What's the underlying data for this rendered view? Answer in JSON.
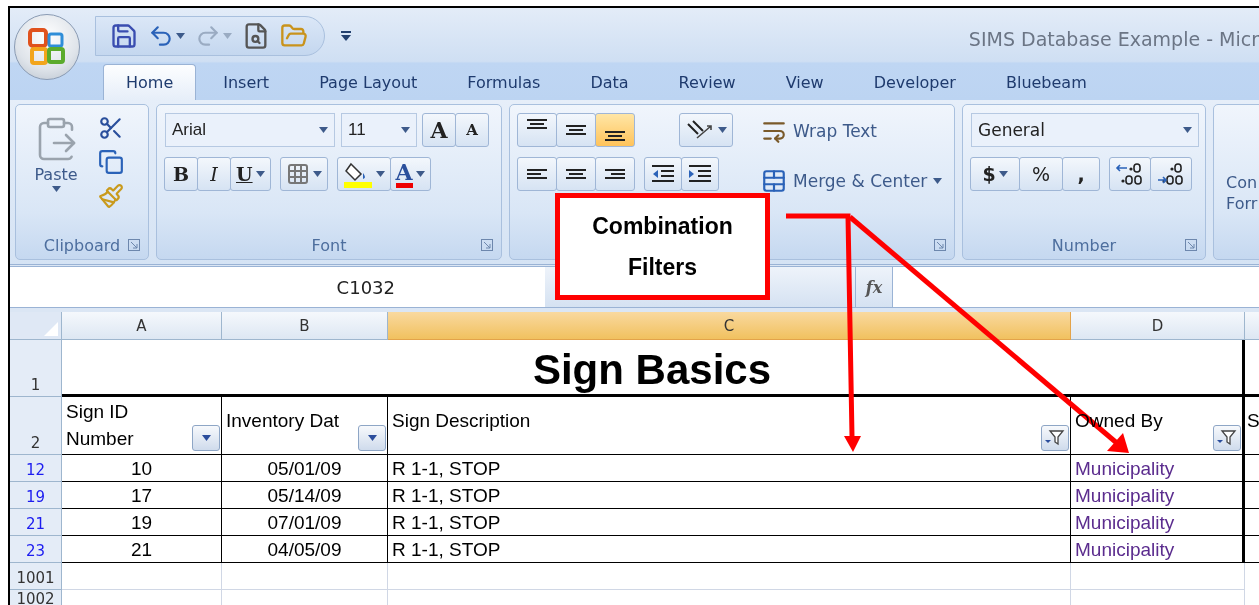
{
  "window": {
    "title": "SIMS Database Example - Micr"
  },
  "tabs": [
    {
      "label": "Home",
      "selected": true
    },
    {
      "label": "Insert",
      "selected": false
    },
    {
      "label": "Page Layout",
      "selected": false
    },
    {
      "label": "Formulas",
      "selected": false
    },
    {
      "label": "Data",
      "selected": false
    },
    {
      "label": "Review",
      "selected": false
    },
    {
      "label": "View",
      "selected": false
    },
    {
      "label": "Developer",
      "selected": false
    },
    {
      "label": "Bluebeam",
      "selected": false
    }
  ],
  "ribbon": {
    "clipboard": {
      "paste": "Paste",
      "label": "Clipboard"
    },
    "font": {
      "name": "Arial",
      "size": "11",
      "grow": "A",
      "shrink": "A",
      "bold": "B",
      "italic": "I",
      "underline": "U",
      "font_color": "A",
      "label": "Font"
    },
    "alignment": {
      "vertical": [
        {
          "selected": false
        },
        {
          "selected": false
        },
        {
          "selected": true
        }
      ],
      "wrap_text": "Wrap Text",
      "merge_center": "Merge & Center"
    },
    "number": {
      "format": "General",
      "currency": "$",
      "percent": "%",
      "comma": ",",
      "label": "Number"
    },
    "styles": {
      "line_1": "Con",
      "line_2": "Forr"
    }
  },
  "formula_bar": {
    "name_box": "C1032",
    "fx": "fx"
  },
  "sheet": {
    "columns": [
      {
        "label": "A",
        "selected": false
      },
      {
        "label": "B",
        "selected": false
      },
      {
        "label": "C",
        "selected": true
      },
      {
        "label": "D",
        "selected": false
      }
    ],
    "title_row_number": "1",
    "title": "Sign Basics",
    "header_row_number": "2",
    "headers": [
      {
        "label": "Sign ID\nNumber",
        "filtered": false
      },
      {
        "label": "Inventory Dat",
        "filtered": false
      },
      {
        "label": "Sign Description",
        "filtered": true
      },
      {
        "label": "Owned By",
        "filtered": true
      },
      {
        "label": "S"
      }
    ],
    "rows": [
      {
        "number": "12",
        "filtered": true,
        "cells": [
          "10",
          "05/01/09",
          "R 1-1, STOP",
          "Municipality"
        ]
      },
      {
        "number": "19",
        "filtered": true,
        "cells": [
          "17",
          "05/14/09",
          "R 1-1, STOP",
          "Municipality"
        ]
      },
      {
        "number": "21",
        "filtered": true,
        "cells": [
          "19",
          "07/01/09",
          "R 1-1, STOP",
          "Municipality"
        ]
      },
      {
        "number": "23",
        "filtered": true,
        "cells": [
          "21",
          "04/05/09",
          "R 1-1, STOP",
          "Municipality"
        ]
      },
      {
        "number": "1001",
        "filtered": false
      },
      {
        "number": "1002",
        "filtered": false
      }
    ]
  },
  "callout": {
    "text": "Combination Filters"
  }
}
